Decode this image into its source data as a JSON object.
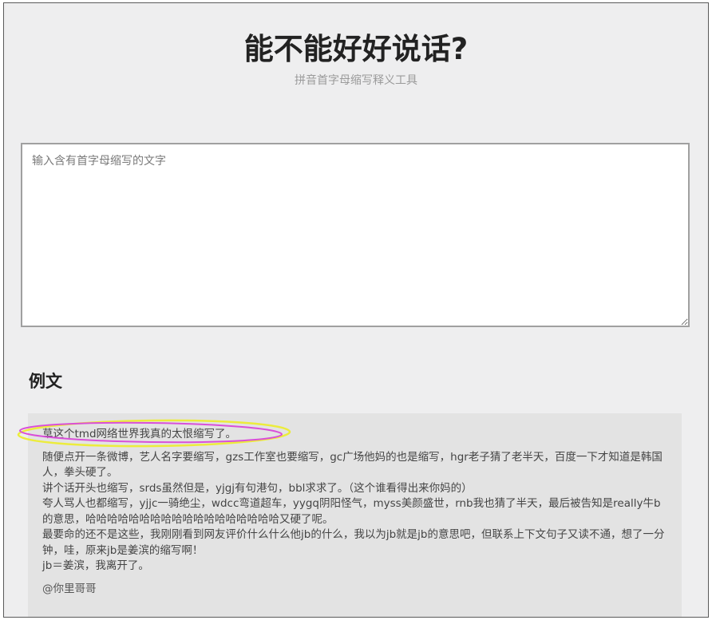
{
  "header": {
    "title": "能不能好好说话?",
    "subtitle": "拼音首字母缩写释义工具"
  },
  "input": {
    "placeholder": "输入含有首字母缩写的文字",
    "value": ""
  },
  "example": {
    "heading": "例文",
    "highlighted_line": "草这个tmd网络世界我真的太恨缩写了。",
    "highlight_colors": {
      "outer": "#ecec3c",
      "inner": "#d94fd9"
    },
    "lines": [
      "随便点开一条微博，艺人名字要缩写，gzs工作室也要缩写，gc广场他妈的也是缩写，hgr老子猜了老半天，百度一下才知道是韩国人，拳头硬了。",
      "讲个话开头也缩写，srds虽然但是，yjgj有句港句，bbl求求了。（这个谁看得出来你妈的）",
      "夸人骂人也都缩写，yjjc一骑绝尘，wdcc弯道超车，yygq阴阳怪气，myss美颜盛世，rnb我也猜了半天，最后被告知是really牛b的意思，哈哈哈哈哈哈哈哈哈哈哈哈哈哈哈哈哈哈又硬了呢。",
      "最要命的还不是这些，我刚刚看到网友评价什么什么他jb的什么，我以为jb就是jb的意思吧，但联系上下文句子又读不通，想了一分钟，哇，原来jb是姜滨的缩写啊！",
      "jb＝姜滨，我离开了。"
    ],
    "signature": "@你里哥哥"
  }
}
